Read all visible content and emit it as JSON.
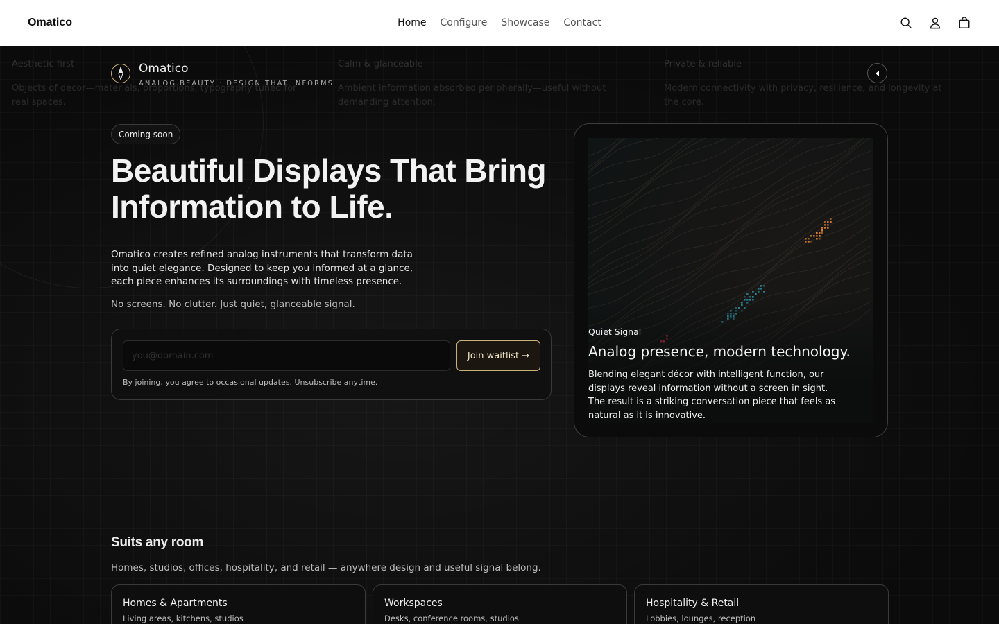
{
  "header": {
    "brand": "Omatico",
    "nav": [
      {
        "label": "Home",
        "active": true
      },
      {
        "label": "Configure",
        "active": false
      },
      {
        "label": "Showcase",
        "active": false
      },
      {
        "label": "Contact",
        "active": false
      }
    ],
    "icons": [
      "search-icon",
      "account-icon",
      "cart-icon"
    ]
  },
  "features": [
    {
      "title": "Aesthetic first",
      "text": "Objects of decor—materials, proportions, typography tuned for real spaces."
    },
    {
      "title": "Calm & glanceable",
      "text": "Ambient information absorbed peripherally—useful without demanding attention."
    },
    {
      "title": "Private & reliable",
      "text": "Modern connectivity with privacy, resilience, and longevity at the core."
    }
  ],
  "logo": {
    "name": "Omatico",
    "tagline": "ANALOG BEAUTY · DESIGN THAT INFORMS"
  },
  "hero": {
    "badge": "Coming soon",
    "title": "Beautiful Displays That Bring Information to Life.",
    "description": "Omatico creates refined analog instruments that transform data into quiet elegance. Designed to keep you informed at a glance, each piece enhances its surroundings with timeless presence.",
    "subline": "No screens. No clutter. Just quiet, glanceable signal."
  },
  "waitlist": {
    "email_placeholder": "you@domain.com",
    "email_value": "",
    "button_label": "Join waitlist →",
    "note": "By joining, you agree to occasional updates. Unsubscribe anytime."
  },
  "device": {
    "kicker": "Quiet Signal",
    "title": "Analog presence, modern technology.",
    "description": "Blending elegant décor with intelligent function, our displays reveal information without a screen in sight. The result is a striking conversation piece that feels as natural as it is innovative."
  },
  "rooms": {
    "title": "Suits any room",
    "subtitle": "Homes, studios, offices, hospitality, and retail — anywhere design and useful signal belong.",
    "cards": [
      {
        "title": "Homes & Apartments",
        "subtitle": "Living areas, kitchens, studios"
      },
      {
        "title": "Workspaces",
        "subtitle": "Desks, conference rooms, studios"
      },
      {
        "title": "Hospitality & Retail",
        "subtitle": "Lobbies, lounges, reception"
      }
    ]
  },
  "colors": {
    "accent_gold": "#c9b27a",
    "background": "#0d0d0d",
    "header_bg": "#ffffff"
  }
}
